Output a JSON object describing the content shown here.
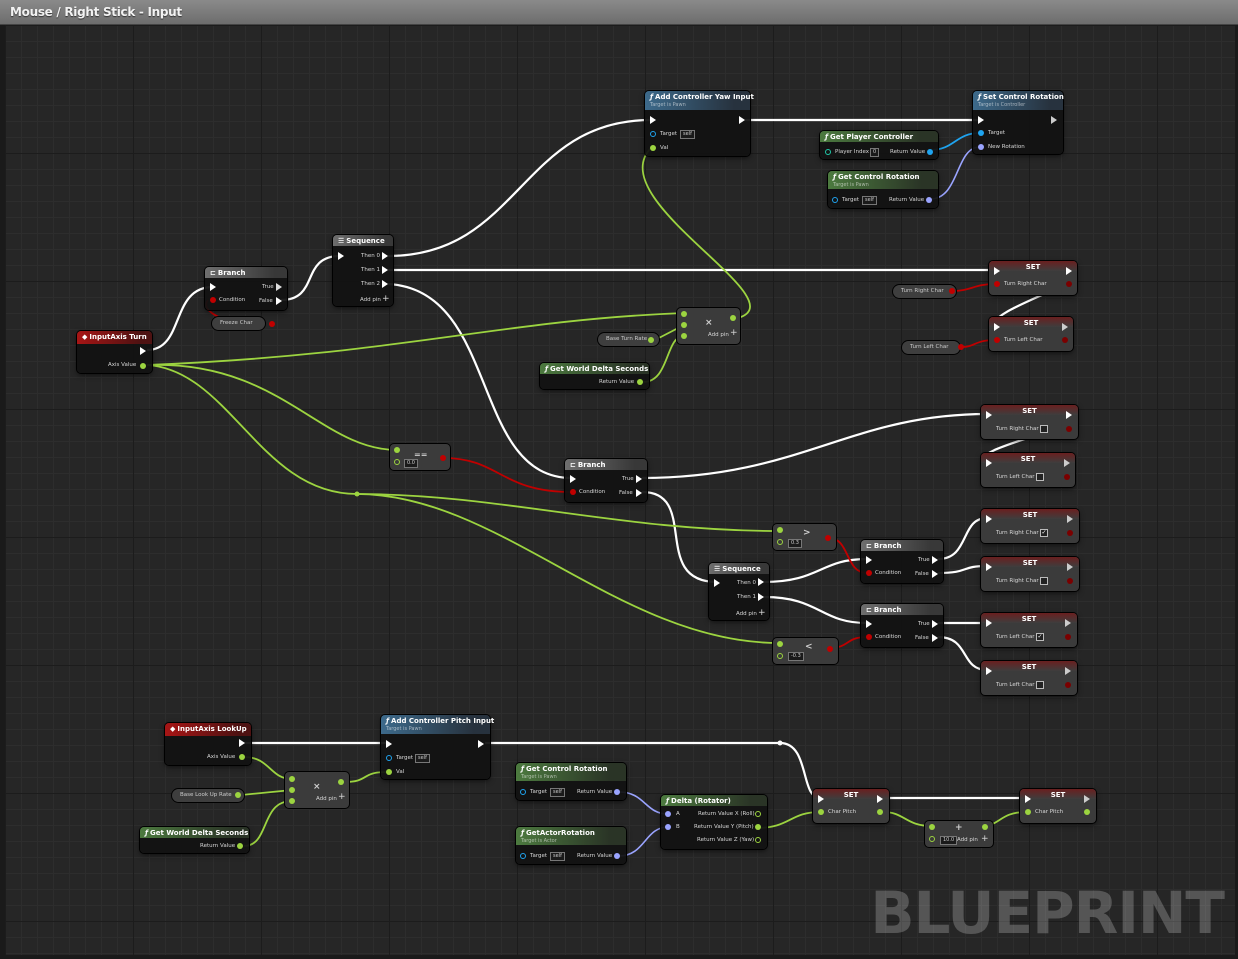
{
  "window": {
    "title": "Mouse / Right Stick - Input",
    "watermark": "BLUEPRINT"
  },
  "colors": {
    "exec": "#ffffff",
    "float": "#9cd440",
    "bool": "#c00000",
    "object": "#1fa4f0",
    "rotator": "#9aa4ff"
  },
  "nodes": {
    "input_turn": {
      "title": "InputAxis Turn",
      "out": "Axis Value"
    },
    "branch_freeze": {
      "title": "Branch",
      "cond": "Condition",
      "t": "True",
      "f": "False"
    },
    "freeze_var": "Freeze Char",
    "sequence_top": {
      "title": "Sequence",
      "p0": "Then 0",
      "p1": "Then 1",
      "p2": "Then 2",
      "add": "Add pin"
    },
    "add_yaw": {
      "title": "Add Controller Yaw Input",
      "sub": "Target is Pawn",
      "target": "Target",
      "self": "self",
      "val": "Val"
    },
    "set_rotation": {
      "title": "Set Control Rotation",
      "sub": "Target is Controller",
      "target": "Target",
      "rot": "New Rotation"
    },
    "get_pc": {
      "title": "Get Player Controller",
      "idx": "Player Index",
      "idxval": "0",
      "ret": "Return Value"
    },
    "get_rot_top": {
      "title": "Get Control Rotation",
      "sub": "Target is Pawn",
      "target": "Target",
      "self": "self",
      "ret": "Return Value"
    },
    "set_tr1": {
      "title": "SET",
      "pin": "Turn Right Char"
    },
    "var_tr": "Turn Right Char",
    "set_tl1": {
      "title": "SET",
      "pin": "Turn Left Char"
    },
    "var_tl": "Turn Left Char",
    "mul_top": {
      "add": "Add pin",
      "sym": "×"
    },
    "base_turn": "Base Turn Rate",
    "delta_top": {
      "title": "Get World Delta Seconds",
      "ret": "Return Value"
    },
    "eq": {
      "val": "0.0",
      "sym": "=="
    },
    "branch_zero": {
      "title": "Branch",
      "cond": "Condition",
      "t": "True",
      "f": "False"
    },
    "set_tr2": {
      "title": "SET",
      "pin": "Turn Right Char"
    },
    "set_tl2": {
      "title": "SET",
      "pin": "Turn Left Char"
    },
    "gt": {
      "val": "0.3",
      "sym": ">"
    },
    "lt": {
      "val": "-0.3",
      "sym": "<"
    },
    "sequence_mid": {
      "title": "Sequence",
      "p0": "Then 0",
      "p1": "Then 1",
      "add": "Add pin"
    },
    "branch_gt": {
      "title": "Branch",
      "cond": "Condition",
      "t": "True",
      "f": "False"
    },
    "branch_lt": {
      "title": "Branch",
      "cond": "Condition",
      "t": "True",
      "f": "False"
    },
    "set_tr3": {
      "title": "SET",
      "pin": "Turn Right Char",
      "checked": true
    },
    "set_tr4": {
      "title": "SET",
      "pin": "Turn Right Char",
      "checked": false
    },
    "set_tl3": {
      "title": "SET",
      "pin": "Turn Left Char",
      "checked": true
    },
    "set_tl4": {
      "title": "SET",
      "pin": "Turn Left Char",
      "checked": false
    },
    "input_lookup": {
      "title": "InputAxis LookUp",
      "out": "Axis Value"
    },
    "base_lookup": "Base Look Up Rate",
    "delta_bottom": {
      "title": "Get World Delta Seconds",
      "ret": "Return Value"
    },
    "mul_bottom": {
      "add": "Add pin",
      "sym": "×"
    },
    "add_pitch": {
      "title": "Add Controller Pitch Input",
      "sub": "Target is Pawn",
      "target": "Target",
      "self": "self",
      "val": "Val"
    },
    "get_rot_bot": {
      "title": "Get Control Rotation",
      "sub": "Target is Pawn",
      "target": "Target",
      "self": "self",
      "ret": "Return Value"
    },
    "get_actor_rot": {
      "title": "GetActorRotation",
      "sub": "Target is Actor",
      "target": "Target",
      "self": "self",
      "ret": "Return Value"
    },
    "delta_rot": {
      "title": "Delta (Rotator)",
      "a": "A",
      "b": "B",
      "x": "Return Value X (Roll)",
      "y": "Return Value Y (Pitch)",
      "z": "Return Value Z (Yaw)"
    },
    "set_pitch1": {
      "title": "SET",
      "pin": "Char Pitch"
    },
    "add_float": {
      "val": "10.0",
      "add": "Add pin",
      "sym": "+"
    },
    "set_pitch2": {
      "title": "SET",
      "pin": "Char Pitch"
    }
  }
}
